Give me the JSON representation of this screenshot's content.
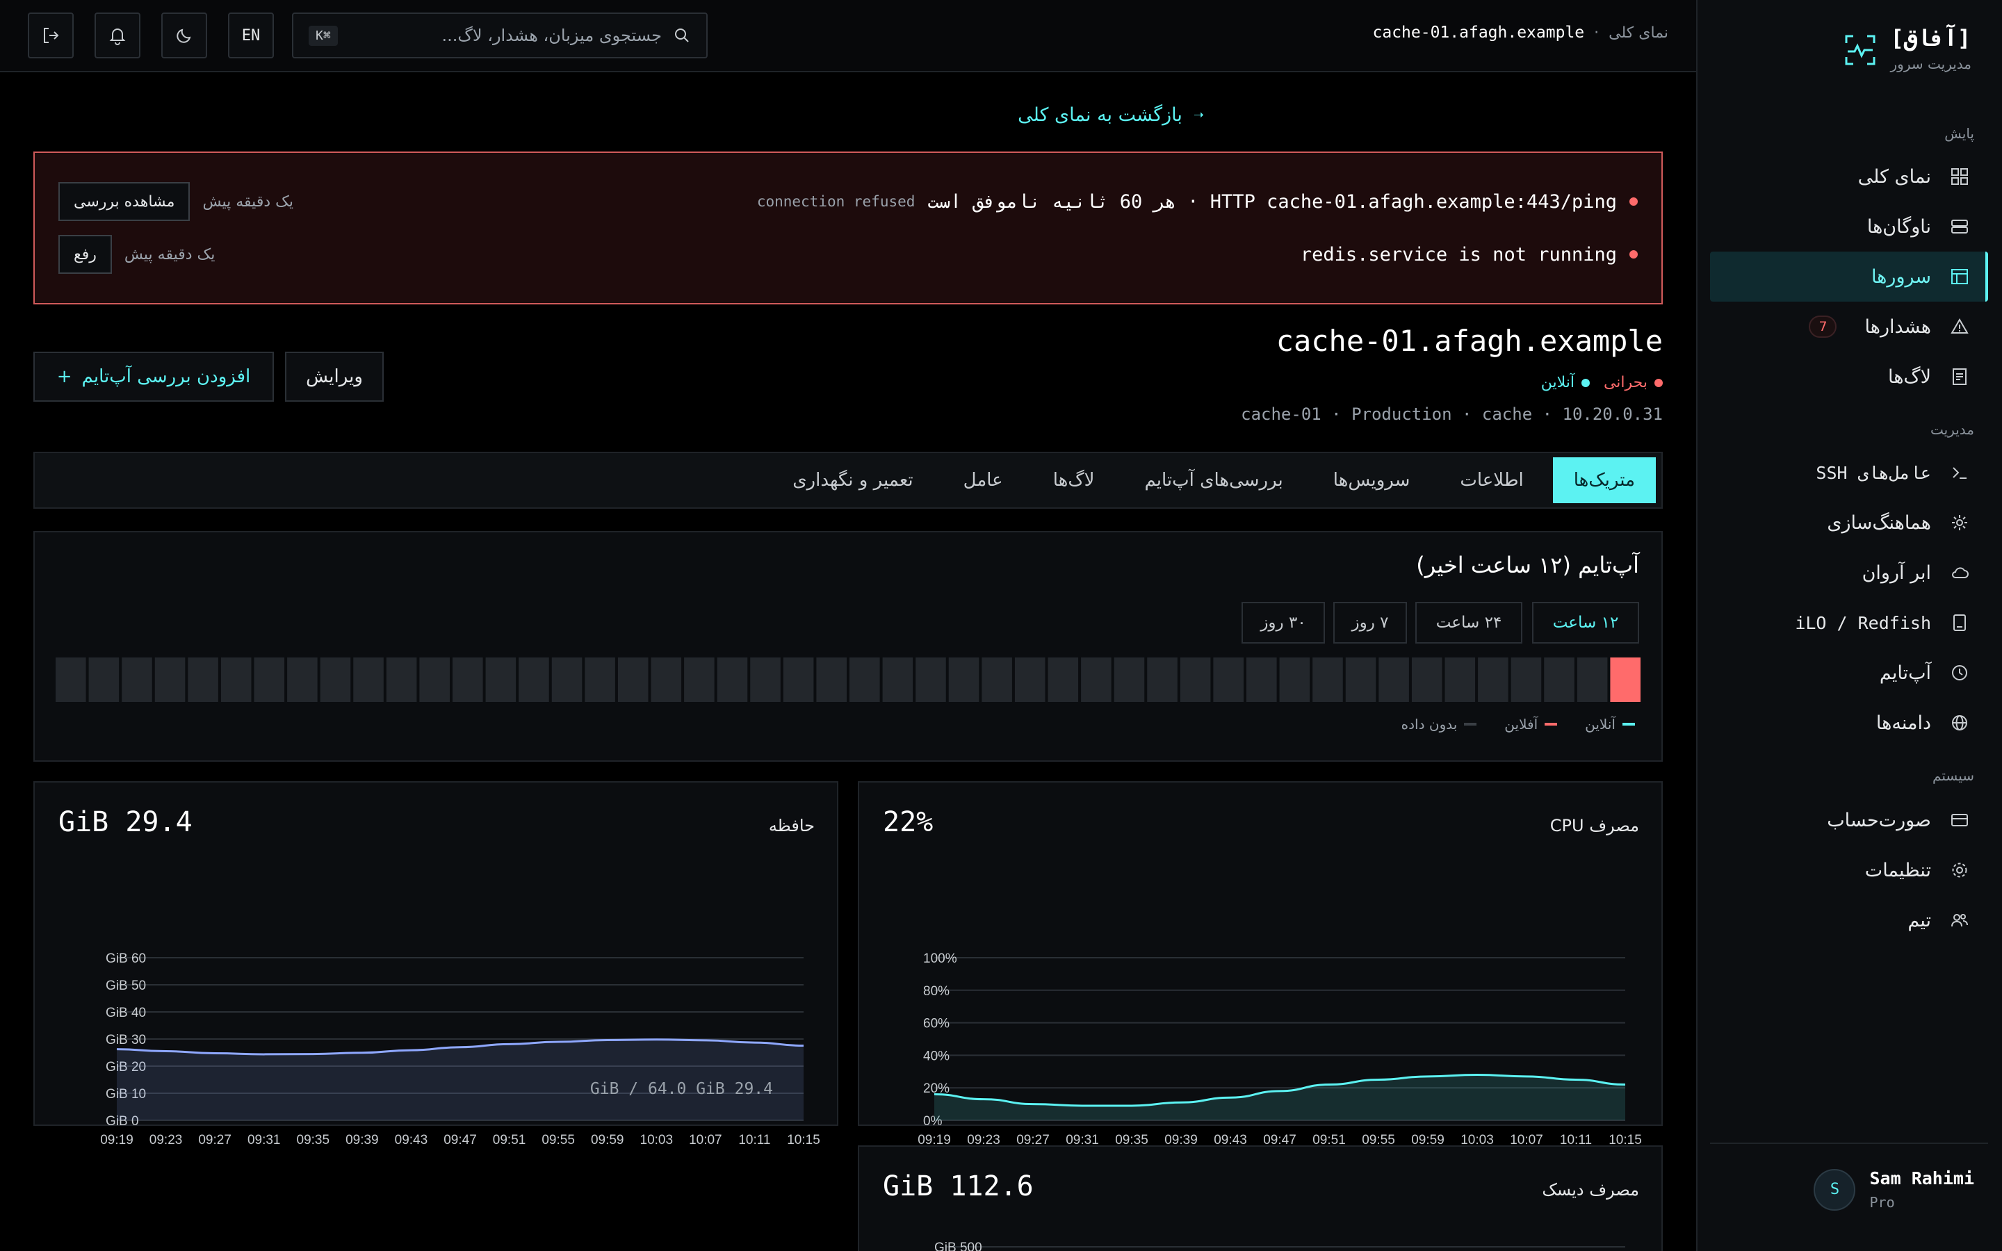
{
  "brand": {
    "title": "[آفاق]",
    "subtitle": "مدیریت سرور"
  },
  "sidebar": {
    "sections": [
      {
        "label": "پایش"
      },
      {
        "label": "مدیریت"
      },
      {
        "label": "سیستم"
      }
    ],
    "items": [
      {
        "label": "نمای کلی",
        "icon": "dashboard-icon"
      },
      {
        "label": "ناوگان‌ها",
        "icon": "server-stack-icon"
      },
      {
        "label": "سرورها",
        "icon": "table-icon",
        "active": true
      },
      {
        "label": "هشدارها",
        "icon": "warning-icon",
        "badge": "7"
      },
      {
        "label": "لاگ‌ها",
        "icon": "document-icon"
      },
      {
        "label": "عامل‌های SSH",
        "icon": "terminal-icon"
      },
      {
        "label": "هماهنگ‌سازی",
        "icon": "gear-sync-icon"
      },
      {
        "label": "ابر آروان",
        "icon": "cloud-icon"
      },
      {
        "label": "iLO / Redfish",
        "icon": "device-icon"
      },
      {
        "label": "آپ‌تایم",
        "icon": "clock-icon"
      },
      {
        "label": "دامنه‌ها",
        "icon": "globe-icon"
      },
      {
        "label": "صورت‌حساب",
        "icon": "card-icon"
      },
      {
        "label": "تنظیمات",
        "icon": "settings-icon"
      },
      {
        "label": "تیم",
        "icon": "team-icon"
      }
    ],
    "user": {
      "name": "Sam Rahimi",
      "plan": "Pro",
      "initial": "S"
    }
  },
  "topbar": {
    "crumb_root": "نمای کلی",
    "crumb_sep": "·",
    "crumb_host": "cache-01.afagh.example",
    "search_placeholder": "جستجوی میزبان، هشدار، لاگ...",
    "search_shortcut": "⌘K",
    "lang": "EN"
  },
  "back_link": "بازگشت به نمای کلی",
  "alerts": [
    {
      "message": "HTTP cache-01.afagh.example:443/ping · هر 60 ثانیه ناموفق است",
      "detail": "connection refused",
      "time": "یک دقیقه پیش",
      "action": "مشاهده بررسی"
    },
    {
      "message": "redis.service is not running",
      "detail": "",
      "time": "یک دقیقه پیش",
      "action": "رفع"
    }
  ],
  "server": {
    "title": "cache-01.afagh.example",
    "status_critical": "بحرانی",
    "status_online": "آنلاین",
    "meta": "cache-01 · Production · cache · 10.20.0.31",
    "edit_label": "ویرایش",
    "add_check_label": "افزودن بررسی آپ‌تایم",
    "add_check_plus": "+"
  },
  "tabs": [
    {
      "label": "متریک‌ها",
      "active": true
    },
    {
      "label": "اطلاعات"
    },
    {
      "label": "سرویس‌ها"
    },
    {
      "label": "بررسی‌های آپ‌تایم"
    },
    {
      "label": "لاگ‌ها"
    },
    {
      "label": "عامل"
    },
    {
      "label": "تعمیر و نگهداری"
    }
  ],
  "uptime": {
    "title": "آپ‌تایم (۱۲ ساعت اخیر)",
    "ranges": [
      "۱۲ ساعت",
      "۲۴ ساعت",
      "۷ روز",
      "۳۰ روز"
    ],
    "active_range": "۱۲ ساعت",
    "bars": [
      "offline",
      "nodata",
      "nodata",
      "nodata",
      "nodata",
      "nodata",
      "nodata",
      "nodata",
      "nodata",
      "nodata",
      "nodata",
      "nodata",
      "nodata",
      "nodata",
      "nodata",
      "nodata",
      "nodata",
      "nodata",
      "nodata",
      "nodata",
      "nodata",
      "nodata",
      "nodata",
      "nodata",
      "nodata",
      "nodata",
      "nodata",
      "nodata",
      "nodata",
      "nodata",
      "nodata",
      "nodata",
      "nodata",
      "nodata",
      "nodata",
      "nodata",
      "nodata",
      "nodata",
      "nodata",
      "nodata",
      "nodata",
      "nodata",
      "nodata",
      "nodata",
      "nodata",
      "nodata",
      "nodata",
      "nodata"
    ],
    "legend": [
      {
        "label": "آنلاین",
        "color": "#5cf2f2"
      },
      {
        "label": "آفلاین",
        "color": "#ff6b6b"
      },
      {
        "label": "بدون داده",
        "color": "#3a3f45"
      }
    ]
  },
  "colors": {
    "accent": "#5cf2f2",
    "critical": "#ff6b6b",
    "memory": "#8fa8ff",
    "bg": "#000000"
  },
  "chart_data": [
    {
      "type": "area",
      "title": "مصرف CPU",
      "current": "22%",
      "x": [
        "09:19",
        "09:23",
        "09:27",
        "09:31",
        "09:35",
        "09:39",
        "09:43",
        "09:47",
        "09:51",
        "09:55",
        "09:59",
        "10:03",
        "10:07",
        "10:11",
        "10:15"
      ],
      "y_ticks": [
        "0%",
        "20%",
        "40%",
        "60%",
        "80%",
        "100%"
      ],
      "ylim": [
        0,
        100
      ],
      "series": [
        {
          "values": [
            16,
            13,
            10,
            9,
            9,
            11,
            14,
            18,
            22,
            25,
            27,
            28,
            27,
            25,
            22
          ]
        }
      ],
      "color": "#5cf2f2"
    },
    {
      "type": "area",
      "title": "حافظه",
      "current": "29.4 GiB",
      "x": [
        "09:19",
        "09:23",
        "09:27",
        "09:31",
        "09:35",
        "09:39",
        "09:43",
        "09:47",
        "09:51",
        "09:55",
        "09:59",
        "10:03",
        "10:07",
        "10:11",
        "10:15"
      ],
      "y_ticks": [
        "GiB 0",
        "GiB 10",
        "GiB 20",
        "GiB 30",
        "GiB 40",
        "GiB 50",
        "GiB 60"
      ],
      "ylim": [
        0,
        64
      ],
      "series": [
        {
          "values": [
            28.0,
            27.2,
            26.4,
            26.0,
            26.1,
            26.6,
            27.6,
            28.8,
            30.0,
            30.9,
            31.6,
            31.8,
            31.5,
            30.6,
            29.4
          ]
        }
      ],
      "color": "#8fa8ff",
      "footer": "GiB / 64.0 GiB 29.4"
    },
    {
      "type": "area",
      "title": "مصرف دیسک",
      "current": "112.6 GiB",
      "y_ticks": [
        "GiB 500"
      ],
      "ylim": [
        0,
        500
      ],
      "color": "#5cf2f2"
    }
  ]
}
